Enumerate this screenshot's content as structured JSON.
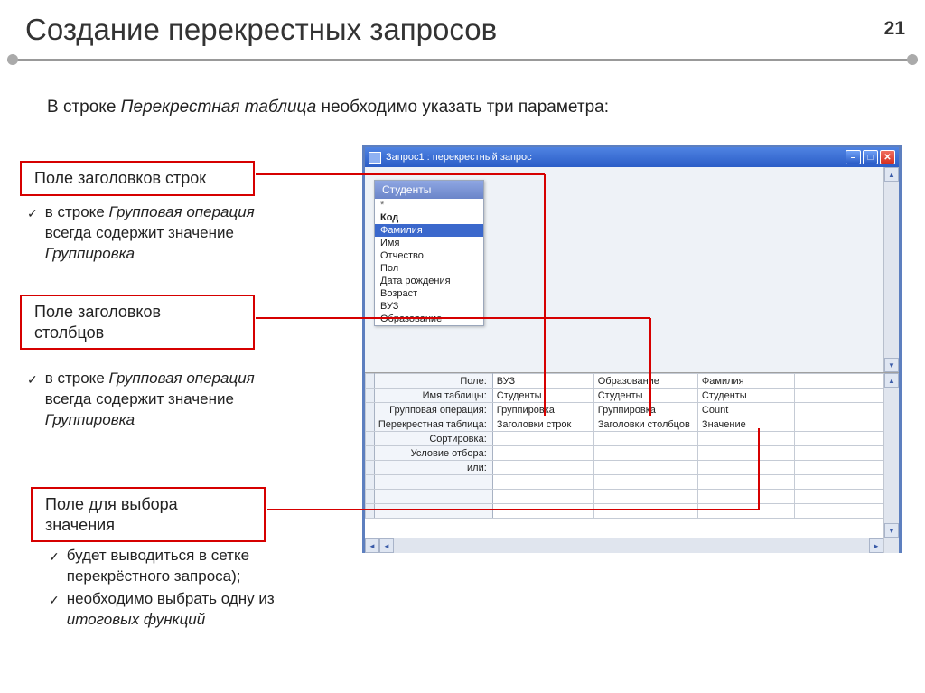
{
  "page": {
    "title": "Создание перекрестных запросов",
    "number": "21",
    "subtitle_lead": "В строке",
    "subtitle_em": "Перекрестная таблица",
    "subtitle_tail": "необходимо указать три параметра:"
  },
  "boxes": {
    "rows": "Поле заголовков строк",
    "cols_l1": "Поле заголовков",
    "cols_l2": "столбцов",
    "val_l1": "Поле для выбора",
    "val_l2": "значения"
  },
  "bullets": {
    "group_op_lead": "в строке",
    "group_op_em1": "Групповая операция",
    "group_op_mid": "всегда содержит значение",
    "group_op_em2": "Группировка",
    "final_1_a": "будет выводиться в сетке",
    "final_1_b": "перекрёстного запроса);",
    "final_2_a": "необходимо выбрать одну из",
    "final_2_em": "итоговых функций"
  },
  "window": {
    "title": "Запрос1 : перекрестный запрос",
    "table_card_header": "Студенты",
    "fields": [
      "*",
      "Код",
      "Фамилия",
      "Имя",
      "Отчество",
      "Пол",
      "Дата рождения",
      "Возраст",
      "ВУЗ",
      "Образование"
    ],
    "selected_field_index": 2,
    "key_field_index": 1,
    "grid_row_labels": [
      "Поле:",
      "Имя таблицы:",
      "Групповая операция:",
      "Перекрестная таблица:",
      "Сортировка:",
      "Условие отбора:",
      "или:",
      "",
      "",
      ""
    ],
    "grid_cols": [
      {
        "field": "ВУЗ",
        "table": "Студенты",
        "groupop": "Группировка",
        "crosstab": "Заголовки строк",
        "sort": "",
        "cond": "",
        "or": ""
      },
      {
        "field": "Образование",
        "table": "Студенты",
        "groupop": "Группировка",
        "crosstab": "Заголовки столбцов",
        "sort": "",
        "cond": "",
        "or": ""
      },
      {
        "field": "Фамилия",
        "table": "Студенты",
        "groupop": "Count",
        "crosstab": "Значение",
        "sort": "",
        "cond": "",
        "or": ""
      }
    ]
  }
}
